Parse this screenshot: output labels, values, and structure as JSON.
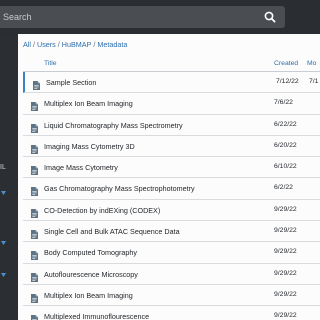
{
  "search": {
    "placeholder": "Search"
  },
  "sidebar": {
    "label_fragment": "IL"
  },
  "breadcrumb": {
    "root": "All",
    "users": "Users",
    "hubmap": "HuBMAP",
    "metadata": "Metadata",
    "separator": "/"
  },
  "table": {
    "columns": {
      "title": "Title",
      "created": "Created",
      "modified": "Mo"
    },
    "rows": [
      {
        "title": "Sample Section",
        "created": "7/12/22",
        "modified": "7/1"
      },
      {
        "title": "Multiplex Ion Beam Imaging",
        "created": "7/6/22",
        "modified": ""
      },
      {
        "title": "Liquid Chromatography Mass Spectrometry",
        "created": "6/22/22",
        "modified": ""
      },
      {
        "title": "Imaging Mass Cytometry 3D",
        "created": "6/20/22",
        "modified": ""
      },
      {
        "title": "Image Mass Cytometry",
        "created": "6/10/22",
        "modified": ""
      },
      {
        "title": "Gas Chromatography Mass Spectrophotometry",
        "created": "6/2/22",
        "modified": ""
      },
      {
        "title": "CO-Detection by indEXing (CODEX)",
        "created": "9/29/22",
        "modified": ""
      },
      {
        "title": "Single Cell and Bulk ATAC Sequence Data",
        "created": "9/29/22",
        "modified": ""
      },
      {
        "title": "Body Computed Tomography",
        "created": "9/29/22",
        "modified": ""
      },
      {
        "title": "Autoflourescence Microscopy",
        "created": "9/29/22",
        "modified": ""
      },
      {
        "title": "Multiplex Ion Beam Imaging",
        "created": "9/29/22",
        "modified": ""
      },
      {
        "title": "Multiplexed Immunoflourescence",
        "created": "9/29/22",
        "modified": ""
      }
    ]
  },
  "colors": {
    "link": "#2d6fad",
    "topbar": "#2a2d31",
    "accent": "#3a83c4"
  },
  "icons": {
    "search": "search-icon",
    "file": "file-icon",
    "sidebar_arrow": "caret-down-icon"
  }
}
